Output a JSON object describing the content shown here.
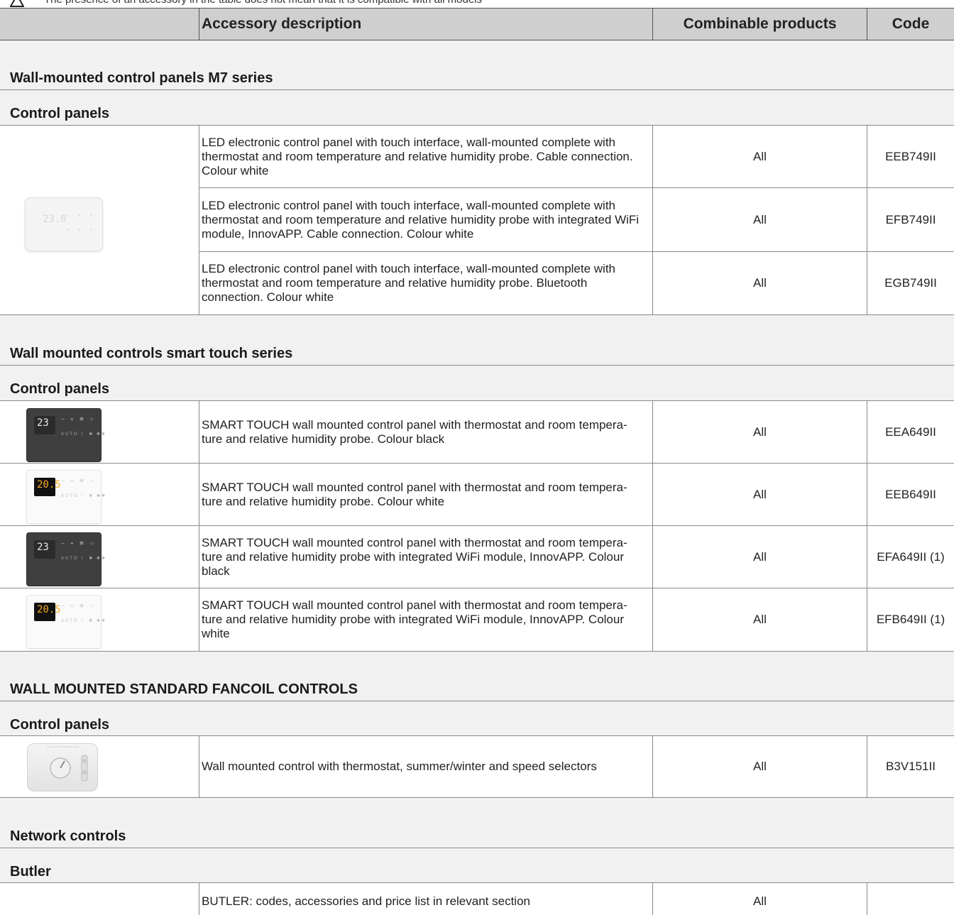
{
  "note": {
    "text": "The presence of an accessory in the table does not mean that it is compatible with all models",
    "text_right": "models"
  },
  "header": {
    "col_description": "Accessory description",
    "col_combinable": "Combinable products",
    "col_code": "Code"
  },
  "sections": [
    {
      "title": "Wall-mounted control panels M7 series",
      "subtitle": "Control panels",
      "rows": [
        {
          "description": "LED electronic control panel with touch interface, wall-mounted complete with thermostat and room temperature and relative humidity probe. Cable connection. Colour white",
          "combinable": "All",
          "code": "EEB749II"
        },
        {
          "description": "LED electronic control panel with touch interface, wall-mounted complete with thermostat and room temperature and relative humidity probe with integrated WiFi module, InnovAPP. Cable connection. Colour white",
          "combinable": "All",
          "code": "EFB749II"
        },
        {
          "description": "LED electronic control panel with touch interface, wall-mounted complete with thermostat and room temperature and relative humidity probe. Bluetooth connection. Colour white",
          "combinable": "All",
          "code": "EGB749II"
        }
      ]
    },
    {
      "title": "Wall mounted controls smart touch series",
      "subtitle": "Control panels",
      "rows": [
        {
          "description": "SMART TOUCH wall mounted control panel with thermostat and room tempera-ture and relative humidity probe. Colour black",
          "combinable": "All",
          "code": "EEA649II"
        },
        {
          "description": "SMART TOUCH wall mounted control panel with thermostat and room tempera-ture and relative humidity probe. Colour white",
          "combinable": "All",
          "code": "EEB649II"
        },
        {
          "description": "SMART TOUCH wall mounted control panel with thermostat and room tempera-ture and relative humidity probe with integrated WiFi module, InnovAPP. Colour black",
          "combinable": "All",
          "code": "EFA649II (1)"
        },
        {
          "description": "SMART TOUCH wall mounted control panel with thermostat and room tempera-ture and relative humidity probe with integrated WiFi module, InnovAPP. Colour white",
          "combinable": "All",
          "code": "EFB649II (1)"
        }
      ]
    },
    {
      "title": "WALL MOUNTED STANDARD FANCOIL CONTROLS",
      "subtitle": "Control panels",
      "rows": [
        {
          "description": "Wall mounted control with thermostat, summer/winter and speed selectors",
          "combinable": "All",
          "code": "B3V151II"
        }
      ]
    },
    {
      "title": "Network controls",
      "subtitle": "Butler",
      "rows": [
        {
          "description": "BUTLER: codes, accessories and price list in relevant section",
          "combinable": "All",
          "code": ""
        }
      ]
    }
  ],
  "devices": {
    "m7_display": "23.0",
    "black_display": "23",
    "white_display": "20.5",
    "keys": "− + ❄ ○",
    "keys_bottom": "AUTO ☾ ✱ ✱✱"
  }
}
